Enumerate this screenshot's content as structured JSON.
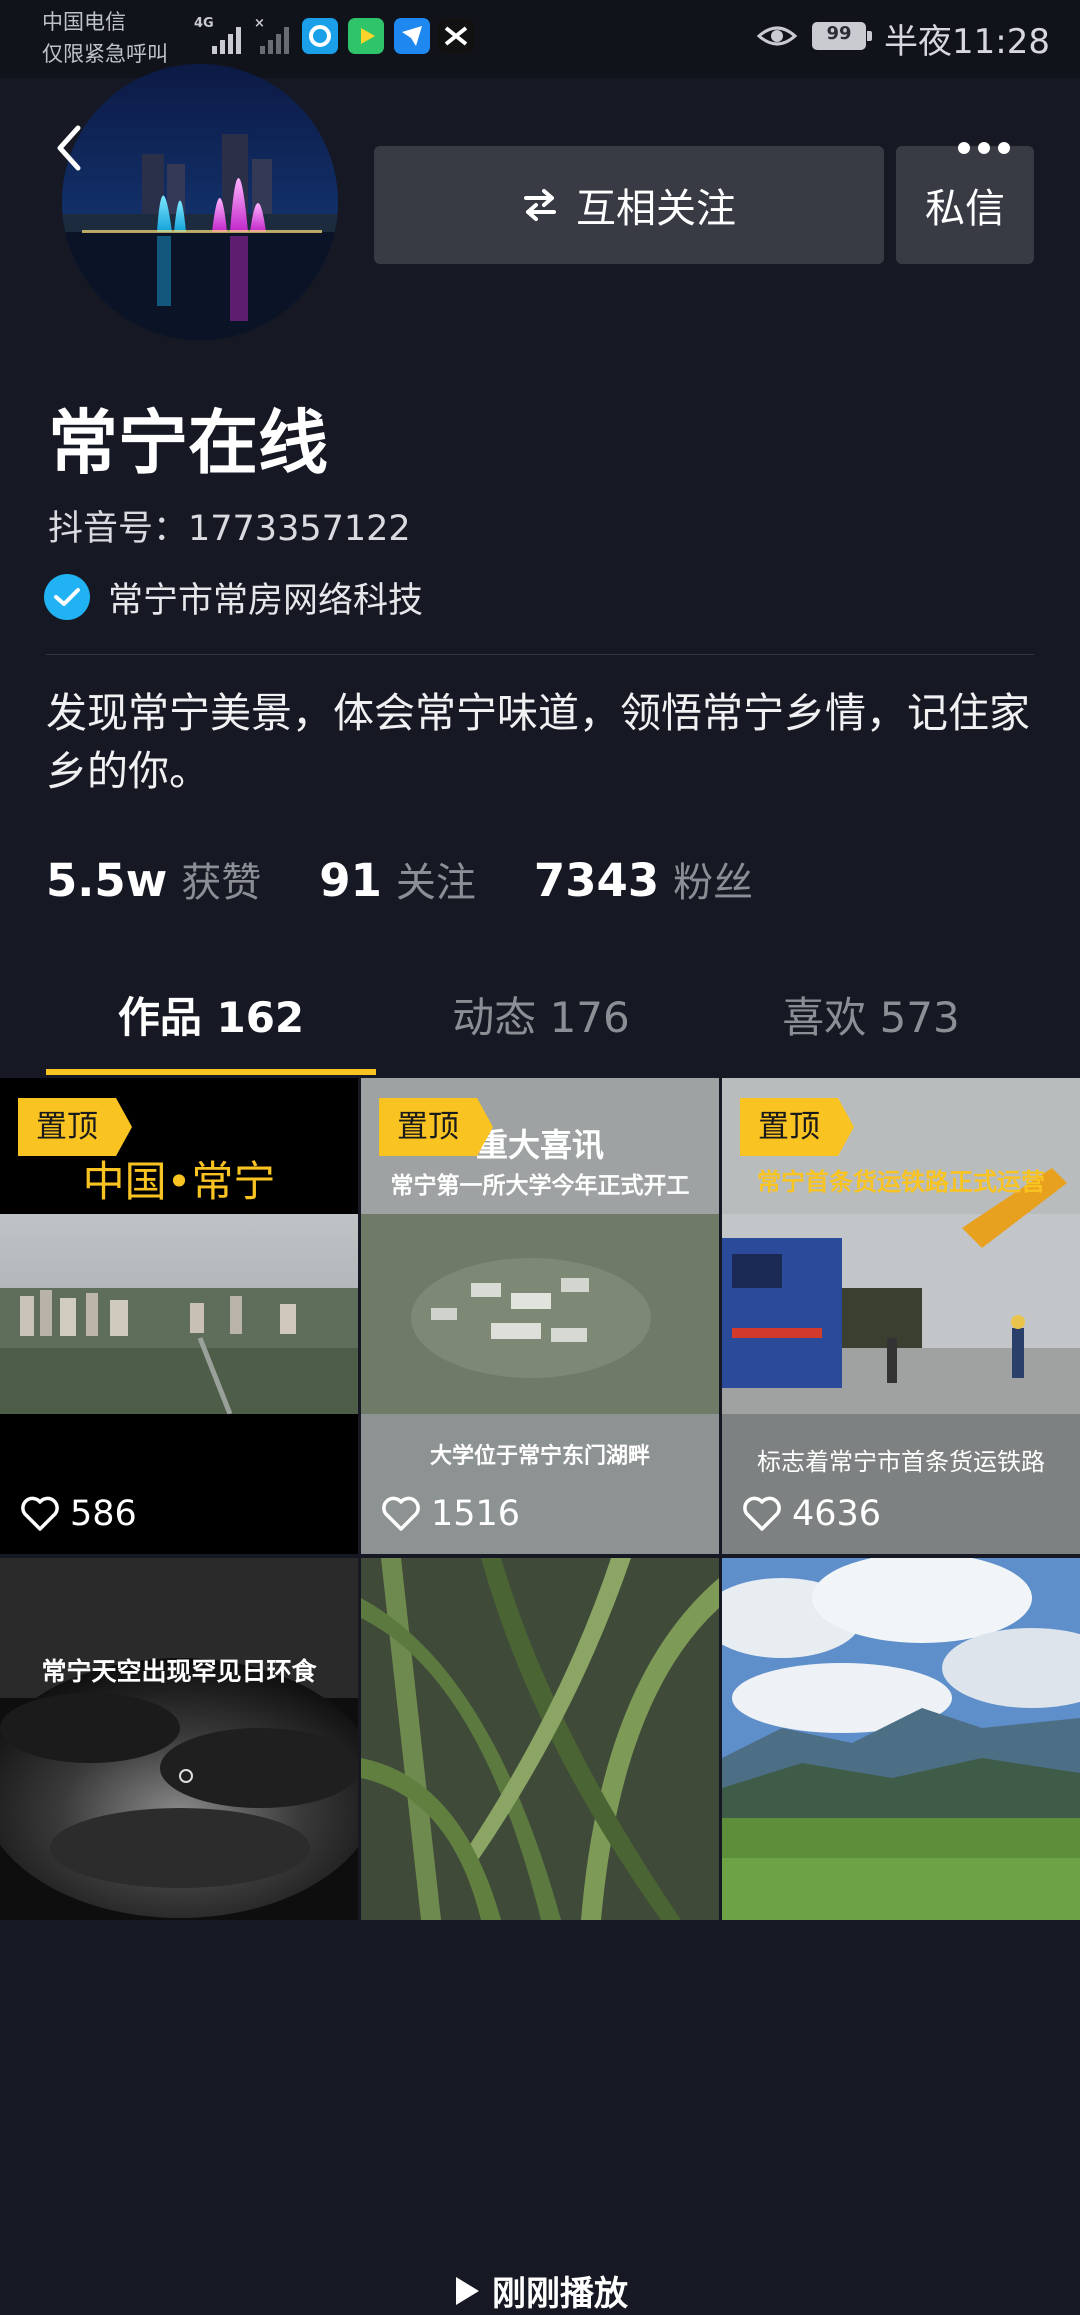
{
  "status_bar": {
    "carrier_line1": "中国电信",
    "carrier_line2": "仅限紧急呼叫",
    "signal_label": "4G",
    "battery": "99",
    "time": "半夜11:28"
  },
  "profile": {
    "follow_button": "互相关注",
    "message_button": "私信",
    "name": "常宁在线",
    "douyin_id": "抖音号：1773357122",
    "organization": "常宁市常房网络科技",
    "bio": "发现常宁美景，体会常宁味道，领悟常宁乡情，记住家乡的你。",
    "stats": [
      {
        "value": "5.5w",
        "label": "获赞"
      },
      {
        "value": "91",
        "label": "关注"
      },
      {
        "value": "7343",
        "label": "粉丝"
      }
    ],
    "verified_color": "#20b2f3"
  },
  "tabs": [
    {
      "label": "作品 162",
      "active": true
    },
    {
      "label": "动态 176",
      "active": false
    },
    {
      "label": "喜欢 573",
      "active": false
    }
  ],
  "accent_color": "#f9c422",
  "videos": [
    {
      "pinned_label": "置顶",
      "overlay_title": "中国•常宁",
      "likes": "586"
    },
    {
      "pinned_label": "置顶",
      "overlay_title": "重大喜讯",
      "overlay_subtitle": "常宁第一所大学今年正式开工",
      "caption": "大学位于常宁东门湖畔",
      "likes": "1516"
    },
    {
      "pinned_label": "置顶",
      "overlay_title": "常宁首条货运铁路正式运营",
      "caption": "标志着常宁市首条货运铁路",
      "likes": "4636"
    },
    {
      "overlay_title": "常宁天空出现罕见日环食"
    },
    {
      "status": "刚刚播放"
    },
    {}
  ]
}
